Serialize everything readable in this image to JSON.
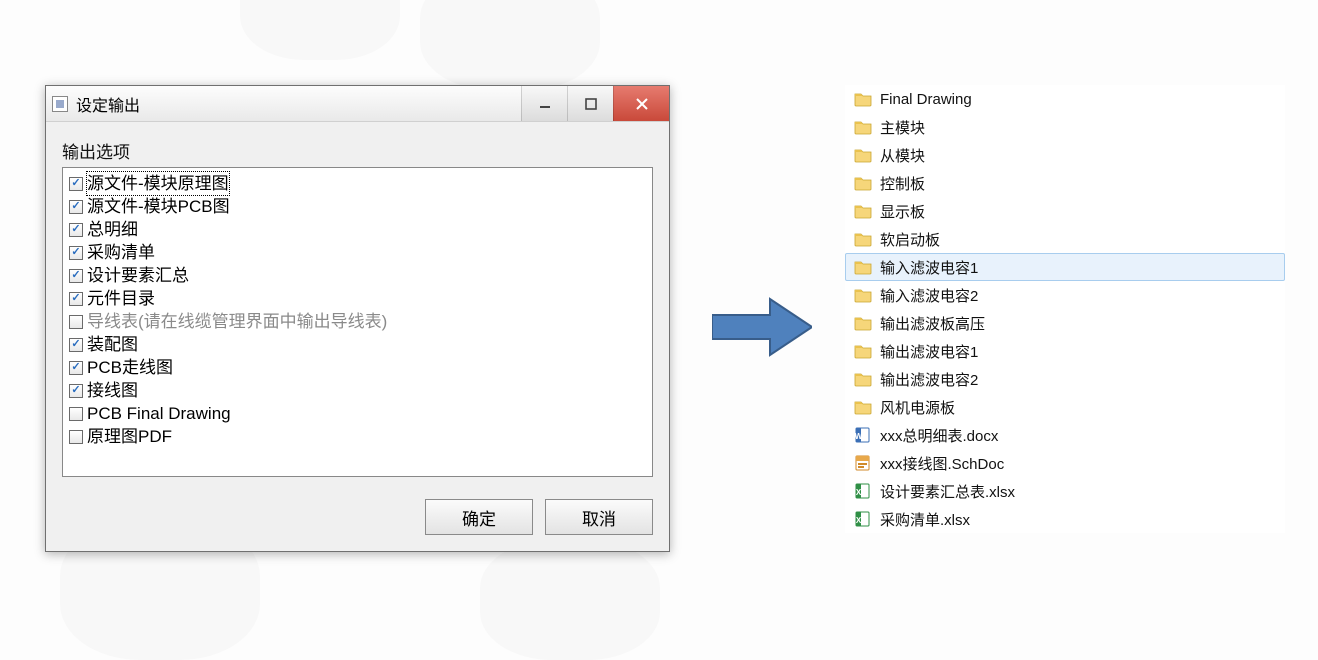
{
  "dialog": {
    "title": "设定输出",
    "section_label": "输出选项",
    "items": [
      {
        "label": "源文件-模块原理图",
        "checked": true,
        "disabled": false,
        "focused": true
      },
      {
        "label": "源文件-模块PCB图",
        "checked": true,
        "disabled": false,
        "focused": false
      },
      {
        "label": "总明细",
        "checked": true,
        "disabled": false,
        "focused": false
      },
      {
        "label": "采购清单",
        "checked": true,
        "disabled": false,
        "focused": false
      },
      {
        "label": "设计要素汇总",
        "checked": true,
        "disabled": false,
        "focused": false
      },
      {
        "label": "元件目录",
        "checked": true,
        "disabled": false,
        "focused": false
      },
      {
        "label": "导线表(请在线缆管理界面中输出导线表)",
        "checked": false,
        "disabled": true,
        "focused": false
      },
      {
        "label": "装配图",
        "checked": true,
        "disabled": false,
        "focused": false
      },
      {
        "label": "PCB走线图",
        "checked": true,
        "disabled": false,
        "focused": false
      },
      {
        "label": "接线图",
        "checked": true,
        "disabled": false,
        "focused": false
      },
      {
        "label": "PCB Final Drawing",
        "checked": false,
        "disabled": false,
        "focused": false
      },
      {
        "label": "原理图PDF",
        "checked": false,
        "disabled": false,
        "focused": false
      }
    ],
    "ok_label": "确定",
    "cancel_label": "取消"
  },
  "files": [
    {
      "name": "Final Drawing",
      "type": "folder",
      "selected": false
    },
    {
      "name": "主模块",
      "type": "folder",
      "selected": false
    },
    {
      "name": "从模块",
      "type": "folder",
      "selected": false
    },
    {
      "name": "控制板",
      "type": "folder",
      "selected": false
    },
    {
      "name": "显示板",
      "type": "folder",
      "selected": false
    },
    {
      "name": "软启动板",
      "type": "folder",
      "selected": false
    },
    {
      "name": "输入滤波电容1",
      "type": "folder",
      "selected": true
    },
    {
      "name": "输入滤波电容2",
      "type": "folder",
      "selected": false
    },
    {
      "name": "输出滤波板高压",
      "type": "folder",
      "selected": false
    },
    {
      "name": "输出滤波电容1",
      "type": "folder",
      "selected": false
    },
    {
      "name": "输出滤波电容2",
      "type": "folder",
      "selected": false
    },
    {
      "name": "风机电源板",
      "type": "folder",
      "selected": false
    },
    {
      "name": "xxx总明细表.docx",
      "type": "docx",
      "selected": false
    },
    {
      "name": "xxx接线图.SchDoc",
      "type": "schdoc",
      "selected": false
    },
    {
      "name": "设计要素汇总表.xlsx",
      "type": "xlsx",
      "selected": false
    },
    {
      "name": "采购清单.xlsx",
      "type": "xlsx",
      "selected": false
    }
  ]
}
